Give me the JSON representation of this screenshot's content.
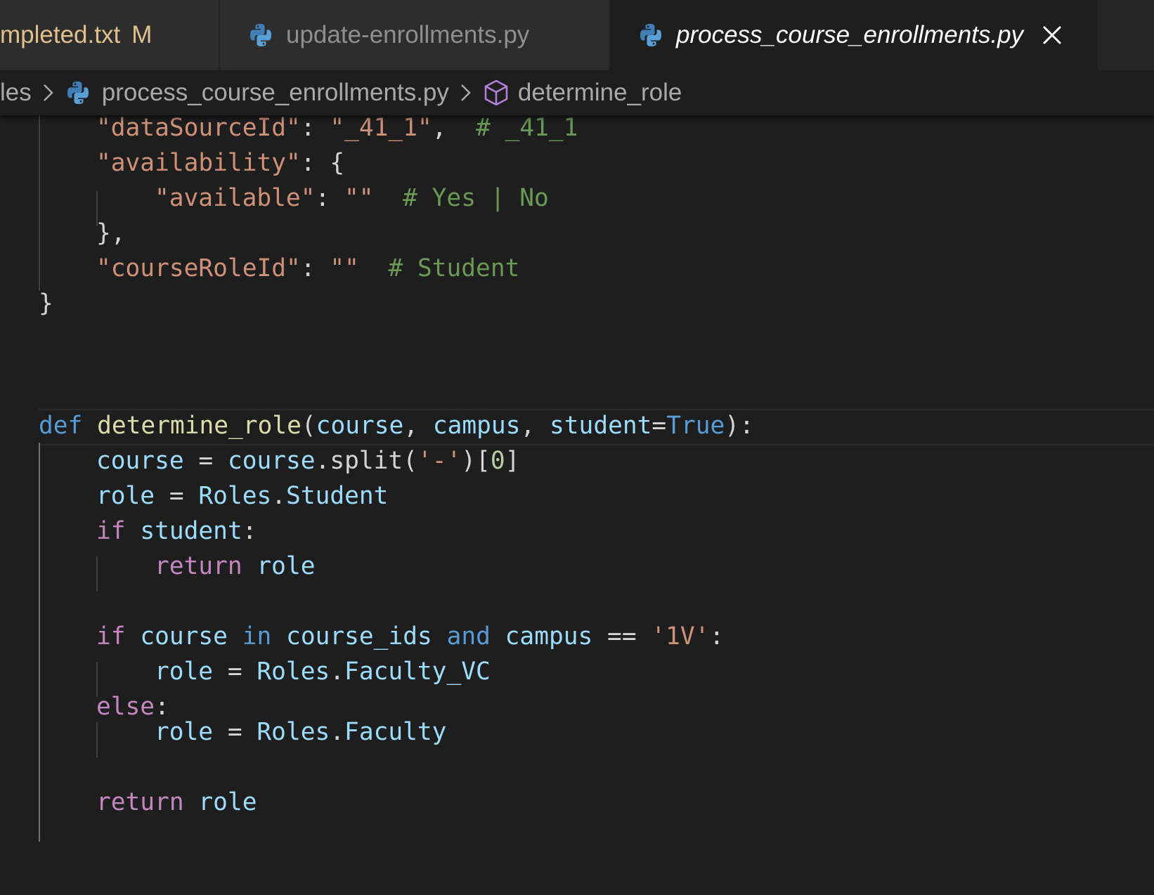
{
  "tabs": [
    {
      "name": "mpleted.txt",
      "badge": "M"
    },
    {
      "name": "update-enrollments.py"
    },
    {
      "name": "process_course_enrollments.py"
    }
  ],
  "breadcrumb": {
    "folder": "les",
    "file": "process_course_enrollments.py",
    "symbol": "determine_role"
  },
  "icons": {
    "python": "python-file-icon",
    "symbol": "cube-method-icon",
    "close": "close-icon",
    "separator": "chevron-right-icon"
  },
  "code": {
    "l1": {
      "key": "\"dataSourceId\"",
      "colon": ": ",
      "val": "\"_41_1\"",
      "comma": ",  ",
      "comment": "# _41_1"
    },
    "l2": {
      "key": "\"availability\"",
      "rest": ": {"
    },
    "l3": {
      "key": "\"available\"",
      "colon": ": ",
      "val": "\"\"",
      "comment": "# Yes | No"
    },
    "l4": {
      "text": "},"
    },
    "l5": {
      "key": "\"courseRoleId\"",
      "colon": ": ",
      "val": "\"\"",
      "comment": "# Student"
    },
    "l6": {
      "text": "}"
    },
    "l7": {
      "def": "def",
      "name": "determine_role",
      "p1": "(",
      "a1": "course",
      "c1": ", ",
      "a2": "campus",
      "c2": ", ",
      "a3": "student",
      "eq": "=",
      "true": "True",
      "p2": "):"
    },
    "l8": {
      "var": "course",
      "op": " = ",
      "obj": "course",
      "dot": ".",
      "method": "split",
      "p1": "(",
      "str": "'-'",
      "p2": ")[",
      "num": "0",
      "p3": "]"
    },
    "l9": {
      "var": "role",
      "op": " = ",
      "cls": "Roles",
      "dot": ".",
      "attr": "Student"
    },
    "l10": {
      "kw": "if",
      "var": "student",
      "colon": ":"
    },
    "l11": {
      "kw": "return",
      "var": "role"
    },
    "l12": {
      "kw": "if",
      "v1": "course",
      "in": "in",
      "v2": "course_ids",
      "and": "and",
      "v3": "campus",
      "op": " == ",
      "str": "'1V'",
      "colon": ":"
    },
    "l13": {
      "var": "role",
      "op": " = ",
      "cls": "Roles",
      "dot": ".",
      "attr": "Faculty_VC"
    },
    "l14": {
      "kw": "else",
      "colon": ":"
    },
    "l15": {
      "var": "role",
      "op": " = ",
      "cls": "Roles",
      "dot": ".",
      "attr": "Faculty"
    },
    "l16": {
      "kw": "return",
      "var": "role"
    }
  },
  "colors": {
    "background": "#1e1e1e",
    "string": "#ce9178",
    "comment": "#6a9955",
    "keyword": "#569cd6",
    "function": "#dcdcaa",
    "variable": "#9cdcfe",
    "class": "#4ec9b0",
    "control": "#c586c0",
    "modified": "#e2c08d"
  }
}
